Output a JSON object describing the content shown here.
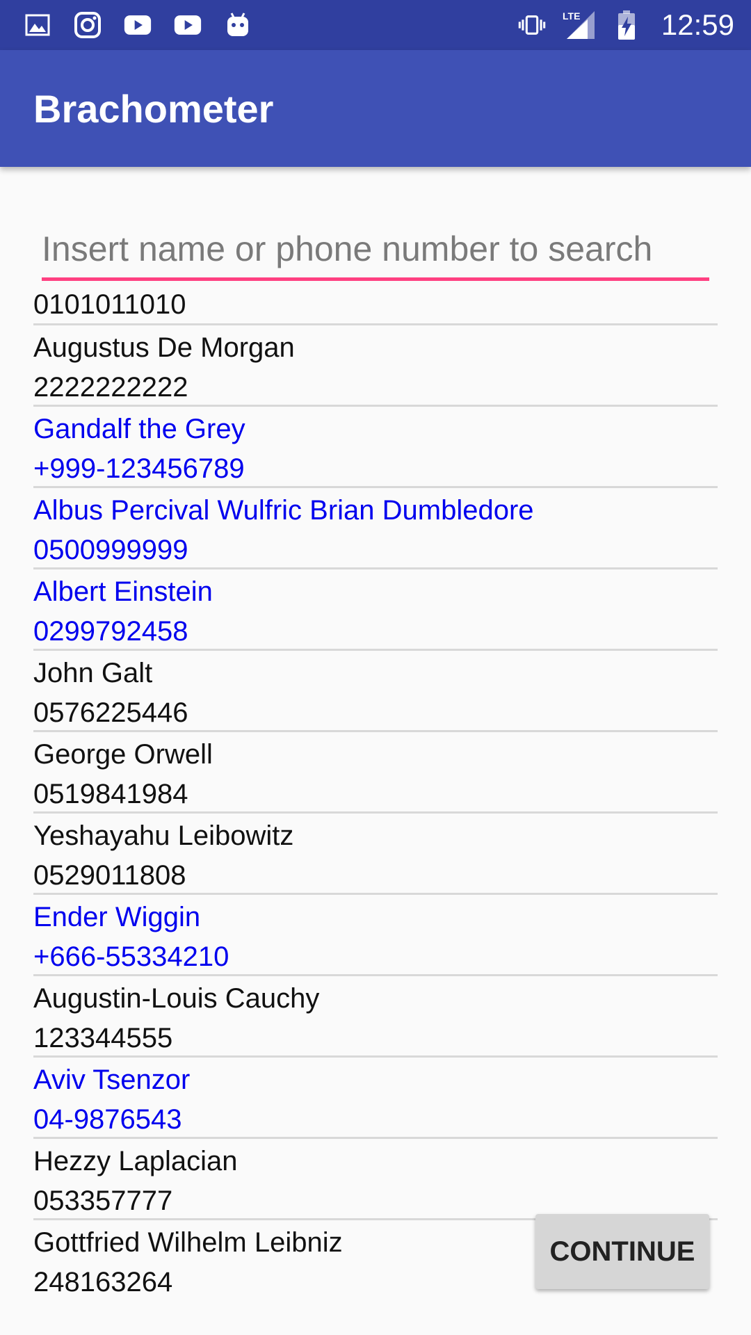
{
  "status_bar": {
    "left_icons": [
      "image-icon",
      "instagram-icon",
      "youtube-icon",
      "youtube-icon",
      "android-icon"
    ],
    "right_icons": [
      "vibrate-icon",
      "lte-signal-icon",
      "battery-charging-icon"
    ],
    "lte_label": "LTE",
    "time": "12:59"
  },
  "app_bar": {
    "title": "Brachometer"
  },
  "search": {
    "placeholder": "Insert name or phone number to search",
    "value": ""
  },
  "contacts": {
    "first_phone": "0101011010",
    "items": [
      {
        "name": "Augustus De Morgan",
        "phone": "2222222222",
        "highlighted": false
      },
      {
        "name": "Gandalf the Grey",
        "phone": "+999-123456789",
        "highlighted": true
      },
      {
        "name": "Albus Percival Wulfric Brian Dumbledore",
        "phone": "0500999999",
        "highlighted": true
      },
      {
        "name": "Albert Einstein",
        "phone": "0299792458",
        "highlighted": true
      },
      {
        "name": "John Galt",
        "phone": "0576225446",
        "highlighted": false
      },
      {
        "name": "George Orwell",
        "phone": "0519841984",
        "highlighted": false
      },
      {
        "name": "Yeshayahu Leibowitz",
        "phone": "0529011808",
        "highlighted": false
      },
      {
        "name": "Ender Wiggin",
        "phone": "+666-55334210",
        "highlighted": true
      },
      {
        "name": "Augustin-Louis Cauchy",
        "phone": "123344555",
        "highlighted": false
      },
      {
        "name": "Aviv Tsenzor",
        "phone": "04-9876543",
        "highlighted": true
      },
      {
        "name": "Hezzy Laplacian",
        "phone": "053357777",
        "highlighted": false
      },
      {
        "name": "Gottfried Wilhelm Leibniz",
        "phone": "248163264",
        "highlighted": false
      }
    ]
  },
  "continue_button": {
    "label": "CONTINUE"
  },
  "colors": {
    "status_bar": "#303f9f",
    "app_bar": "#3f51b5",
    "accent": "#ff4081",
    "highlight_text": "#0000ee"
  }
}
